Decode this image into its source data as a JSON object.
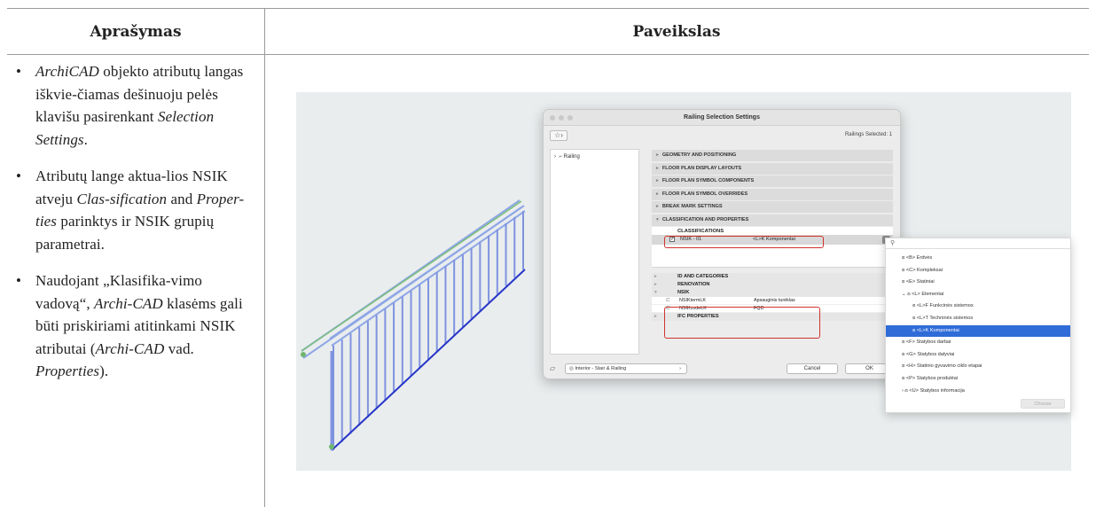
{
  "table": {
    "col1_header": "Aprašymas",
    "col2_header": "Paveikslas"
  },
  "description": {
    "b1_a": "ArchiCAD",
    "b1_b": " objekto atributų langas iškvie-čiamas dešinuoju pelės klavišu pasirenkant ",
    "b1_c": "Selection Settings",
    "b1_d": ".",
    "b2_a": "Atributų lange aktua-lios NSIK atveju ",
    "b2_b": "Clas-sification",
    "b2_c": " and ",
    "b2_d": "Proper-ties",
    "b2_e": " parinktys ir NSIK grupių parametrai.",
    "b3_a": "Naudojant „Klasifika-vimo vadovą“, ",
    "b3_b": "Archi-CAD",
    "b3_c": " klasėms gali būti priskiriami atitinkami NSIK atributai (",
    "b3_d": "Archi-CAD",
    "b3_e": " vad. ",
    "b3_f": "Properties",
    "b3_g": ")."
  },
  "dialog": {
    "title": "Railing Selection Settings",
    "selected": "Railings Selected: 1",
    "tree_item": "Railing",
    "panels": [
      "GEOMETRY AND POSITIONING",
      "FLOOR PLAN DISPLAY LAYOUTS",
      "FLOOR PLAN SYMBOL COMPONENTS",
      "FLOOR PLAN SYMBOL OVERRIDES",
      "BREAK MARK SETTINGS",
      "CLASSIFICATION AND PROPERTIES"
    ],
    "classifications_label": "CLASSIFICATIONS",
    "class_key": "NSIK - 01",
    "class_value": "<L>K Komponentai",
    "groups": [
      "ID AND CATEGORIES",
      "RENOVATION",
      "NSIK",
      "IFC PROPERTIES"
    ],
    "nsik_rows": [
      {
        "key": "NSIKtermLK",
        "value": "Apsauginis turėklas"
      },
      {
        "key": "NSIKcodeLK",
        "value": "FQD"
      }
    ],
    "favorite_select": "Interior - Stair & Railing",
    "cancel": "Cancel",
    "ok": "OK"
  },
  "menu": {
    "items": [
      "<B> Erdvės",
      "<C> Kompleksai",
      "<E> Statiniai",
      "<L> Elementai",
      "<L>F Funkcinės sistemos",
      "<L>T Techninės sistemos",
      "<L>K Komponentai",
      "<F> Statybos darbai",
      "<G> Statybos dalyviai",
      "<H> Statinio gyvavimo ciklo etapai",
      "<P> Statybos produktai",
      "<U> Statybos informacija"
    ],
    "choose": "Choose"
  },
  "colors": {
    "highlight": "#2f6cd8",
    "callout": "#d0332e",
    "figure_bg": "#e9edee"
  }
}
